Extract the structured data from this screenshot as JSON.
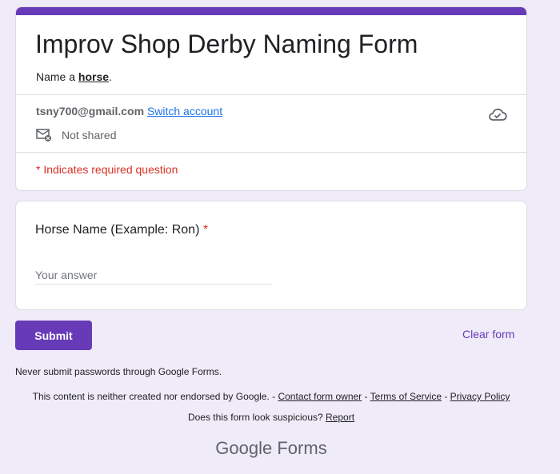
{
  "form": {
    "title": "Improv Shop Derby Naming Form",
    "description_prefix": "Name a ",
    "description_bold": "horse",
    "description_suffix": "."
  },
  "account": {
    "email": "tsny700@gmail.com",
    "switch_label": "Switch account",
    "not_shared": "Not shared"
  },
  "required_note": "* Indicates required question",
  "question": {
    "title": "Horse Name (Example: Ron)",
    "required_mark": "*",
    "placeholder": "Your answer",
    "value": ""
  },
  "actions": {
    "submit": "Submit",
    "clear": "Clear form"
  },
  "footer": {
    "password_note": "Never submit passwords through Google Forms.",
    "disclaimer": "This content is neither created nor endorsed by Google. - ",
    "contact_link": "Contact form owner",
    "sep1": " - ",
    "terms_link": "Terms of Service",
    "sep2": " - ",
    "privacy_link": "Privacy Policy",
    "suspicious_prefix": "Does this form look suspicious? ",
    "report_link": "Report",
    "brand_google": "Google",
    "brand_forms": " Forms"
  },
  "colors": {
    "accent": "#673ab7",
    "background": "#f0ebf8",
    "required": "#d93025",
    "link": "#1a73e8"
  },
  "icons": {
    "cloud": "cloud-done-icon",
    "mail": "mail-off-icon"
  }
}
